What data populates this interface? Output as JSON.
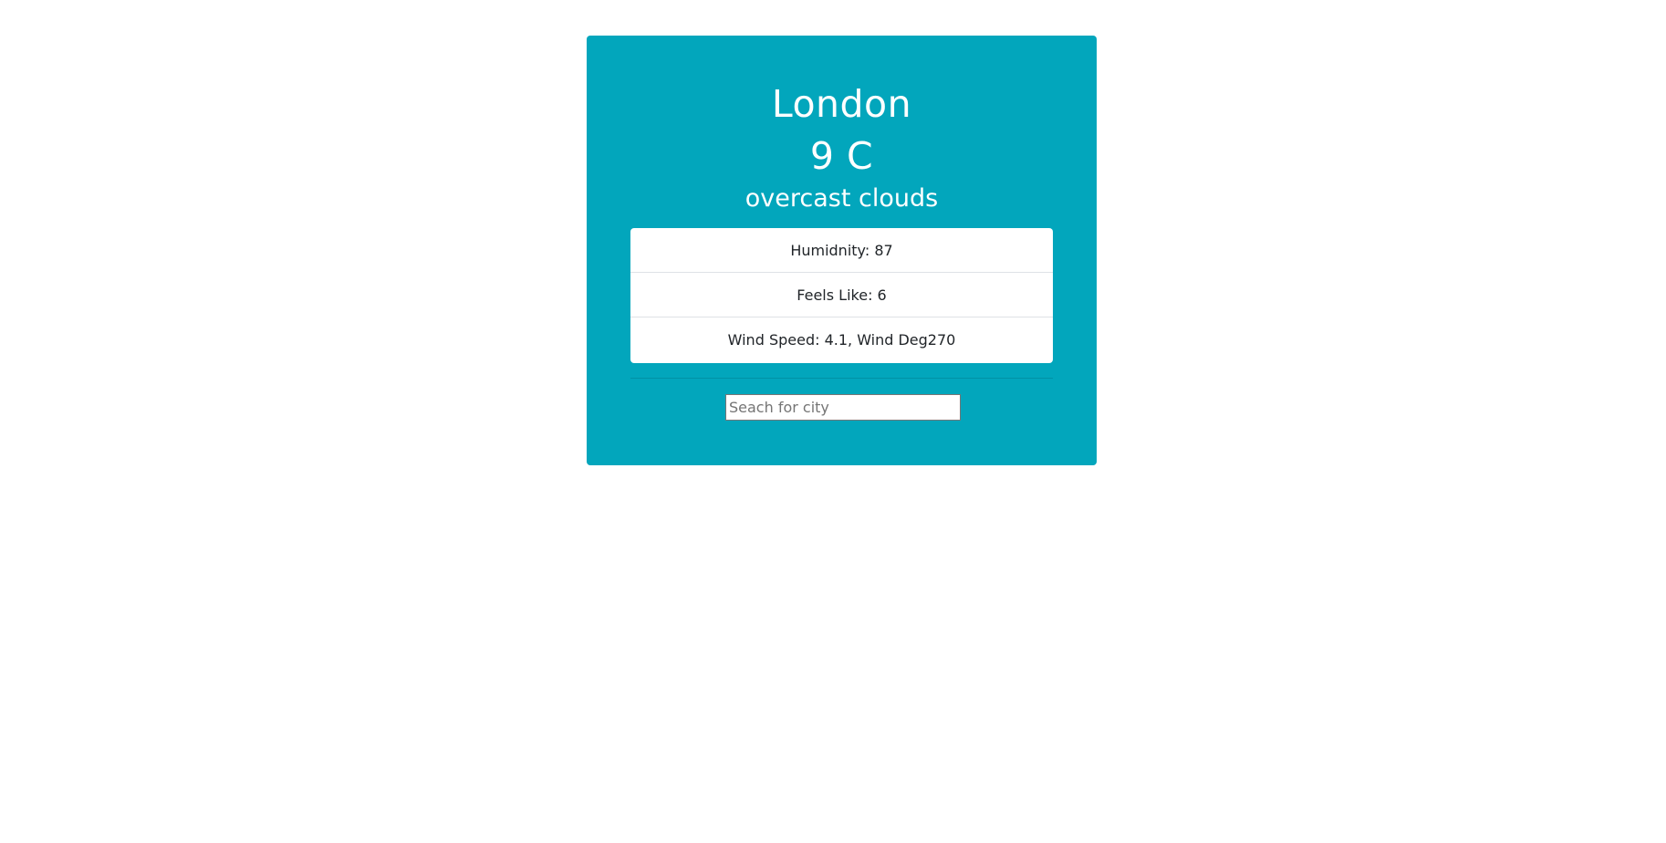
{
  "weather": {
    "city": "London",
    "temperature": "9 C",
    "description": "overcast clouds",
    "details": [
      "Humidnity: 87",
      "Feels Like: 6",
      "Wind Speed: 4.1, Wind Deg270"
    ]
  },
  "search": {
    "value": "",
    "placeholder": "Seach for city"
  },
  "colors": {
    "card_background": "#02a6bc",
    "text_primary": "#ffffff",
    "list_background": "#ffffff"
  }
}
